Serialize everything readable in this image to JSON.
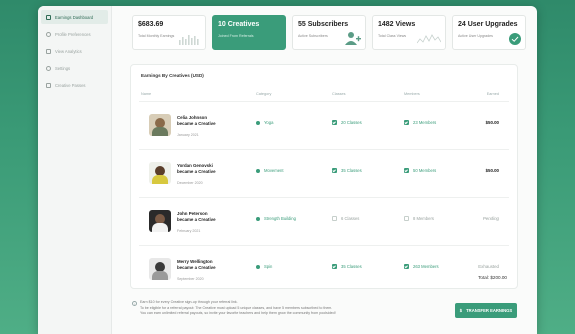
{
  "sidebar": {
    "items": [
      {
        "label": "Earnings Dashboard",
        "active": true,
        "icon": "grid-icon"
      },
      {
        "label": "Profile Preferences",
        "active": false,
        "icon": "user-icon"
      },
      {
        "label": "View Analytics",
        "active": false,
        "icon": "chart-icon"
      },
      {
        "label": "Settings",
        "active": false,
        "icon": "gear-icon"
      },
      {
        "label": "Creative Passes",
        "active": false,
        "icon": "ticket-icon"
      }
    ]
  },
  "cards": [
    {
      "value": "$683.69",
      "sub": "Total Monthly Earnings"
    },
    {
      "value": "10 Creatives",
      "sub": "Joined From Referrals"
    },
    {
      "value": "55 Subscribers",
      "sub": "Active Subscribers"
    },
    {
      "value": "1482 Views",
      "sub": "Total Class Views"
    },
    {
      "value": "24 User Upgrades",
      "sub": "Active User Upgrades"
    }
  ],
  "panel": {
    "title": "Earnings By Creatives (USD)",
    "columns": [
      "Name",
      "Category",
      "Classes",
      "Members",
      "Earned"
    ],
    "rows": [
      {
        "name1": "Celia Johnson",
        "name2": "became a Creative",
        "date": "January 2021",
        "category": "Yoga",
        "classes": "20 Classes",
        "members": "23 Members",
        "earned": "$50.00"
      },
      {
        "name1": "Yordan Genovski",
        "name2": "became a Creative",
        "date": "December 2020",
        "category": "Movement",
        "classes": "35 Classes",
        "members": "50 Members",
        "earned": "$50.00"
      },
      {
        "name1": "John Peterson",
        "name2": "became a Creative",
        "date": "February 2021",
        "category": "Strength Building",
        "classes": "6 Classes",
        "members": "8 Members",
        "earned": "Pending"
      },
      {
        "name1": "Merry Wellington",
        "name2": "became a Creative",
        "date": "September 2020",
        "category": "Spin",
        "classes": "35 Classes",
        "members": "263 Members",
        "earned": "Exhausted"
      }
    ],
    "total": "Total: $200.00"
  },
  "footer": {
    "line1": "Earn $10 for every Creative sign-up through your referral link.",
    "line2": "To be eligible for a referral payout: The Creative must upload 5 unique classes, and have 5 members subscribed to them.",
    "line3": "You can earn unlimited referral payouts, so invite your favorite teachers and help them grow the community from poolsided!",
    "button": "TRANSFER EARNINGS"
  },
  "colors": {
    "accent": "#3a9c7a",
    "background": "#3a9a76"
  }
}
